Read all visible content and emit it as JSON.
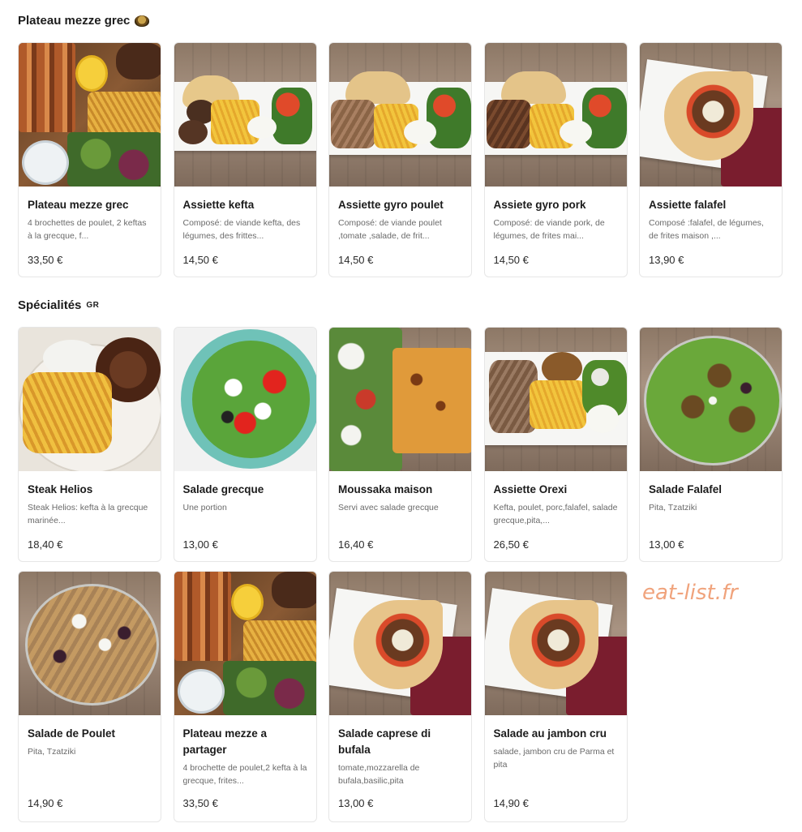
{
  "sections": [
    {
      "title": "Plateau mezze grec",
      "icon": "food-icon",
      "items": [
        {
          "name": "Plateau mezze grec",
          "desc": "4 brochettes de poulet, 2 keftas à la grecque, f...",
          "price": "33,50 €",
          "image": "mezze-platter"
        },
        {
          "name": "Assiette kefta",
          "desc": "Composé: de viande kefta, des légumes, des frittes...",
          "price": "14,50 €",
          "image": "kefta-plate"
        },
        {
          "name": "Assiette gyro poulet",
          "desc": "Composé: de viande poulet ,tomate ,salade, de frit...",
          "price": "14,50 €",
          "image": "gyro-plate"
        },
        {
          "name": "Assiete gyro pork",
          "desc": "Composé: de viande pork, de légumes, de frites mai...",
          "price": "14,50 €",
          "image": "gyro-plate"
        },
        {
          "name": "Assiette falafel",
          "desc": "Composé :falafel, de légumes, de frites maison ,...",
          "price": "13,90 €",
          "image": "wrap"
        }
      ]
    },
    {
      "title": "Spécialités",
      "badge": "GR",
      "items": [
        {
          "name": "Steak Helios",
          "desc": "Steak Helios: kefta à la grecque marinée...",
          "price": "18,40 €",
          "image": "steak-fries"
        },
        {
          "name": "Salade grecque",
          "desc": "Une portion",
          "price": "13,00 €",
          "image": "greek-salad"
        },
        {
          "name": "Moussaka maison",
          "desc": "Servi avec salade grecque",
          "price": "16,40 €",
          "image": "moussaka"
        },
        {
          "name": "Assiette Orexi",
          "desc": "Kefta, poulet, porc,falafel, salade grecque,pita,...",
          "price": "26,50 €",
          "image": "orexi-plate"
        },
        {
          "name": "Salade Falafel",
          "desc": "Pita, Tzatziki",
          "price": "13,00 €",
          "image": "falafel-salad"
        },
        {
          "name": "Salade de Poulet",
          "desc": "Pita, Tzatziki",
          "price": "14,90 €",
          "image": "chicken-salad"
        },
        {
          "name": "Plateau mezze a partager",
          "desc": "4 brochette de poulet,2 kefta à la grecque, frites...",
          "price": "33,50 €",
          "image": "mezze-platter"
        },
        {
          "name": "Salade caprese di bufala",
          "desc": "tomate,mozzarella de bufala,basilic,pita",
          "price": "13,00 €",
          "image": "wrap"
        },
        {
          "name": "Salade au jambon cru",
          "desc": "salade, jambon cru de Parma et pita",
          "price": "14,90 €",
          "image": "wrap"
        }
      ]
    }
  ],
  "watermark": "eat-list.fr"
}
